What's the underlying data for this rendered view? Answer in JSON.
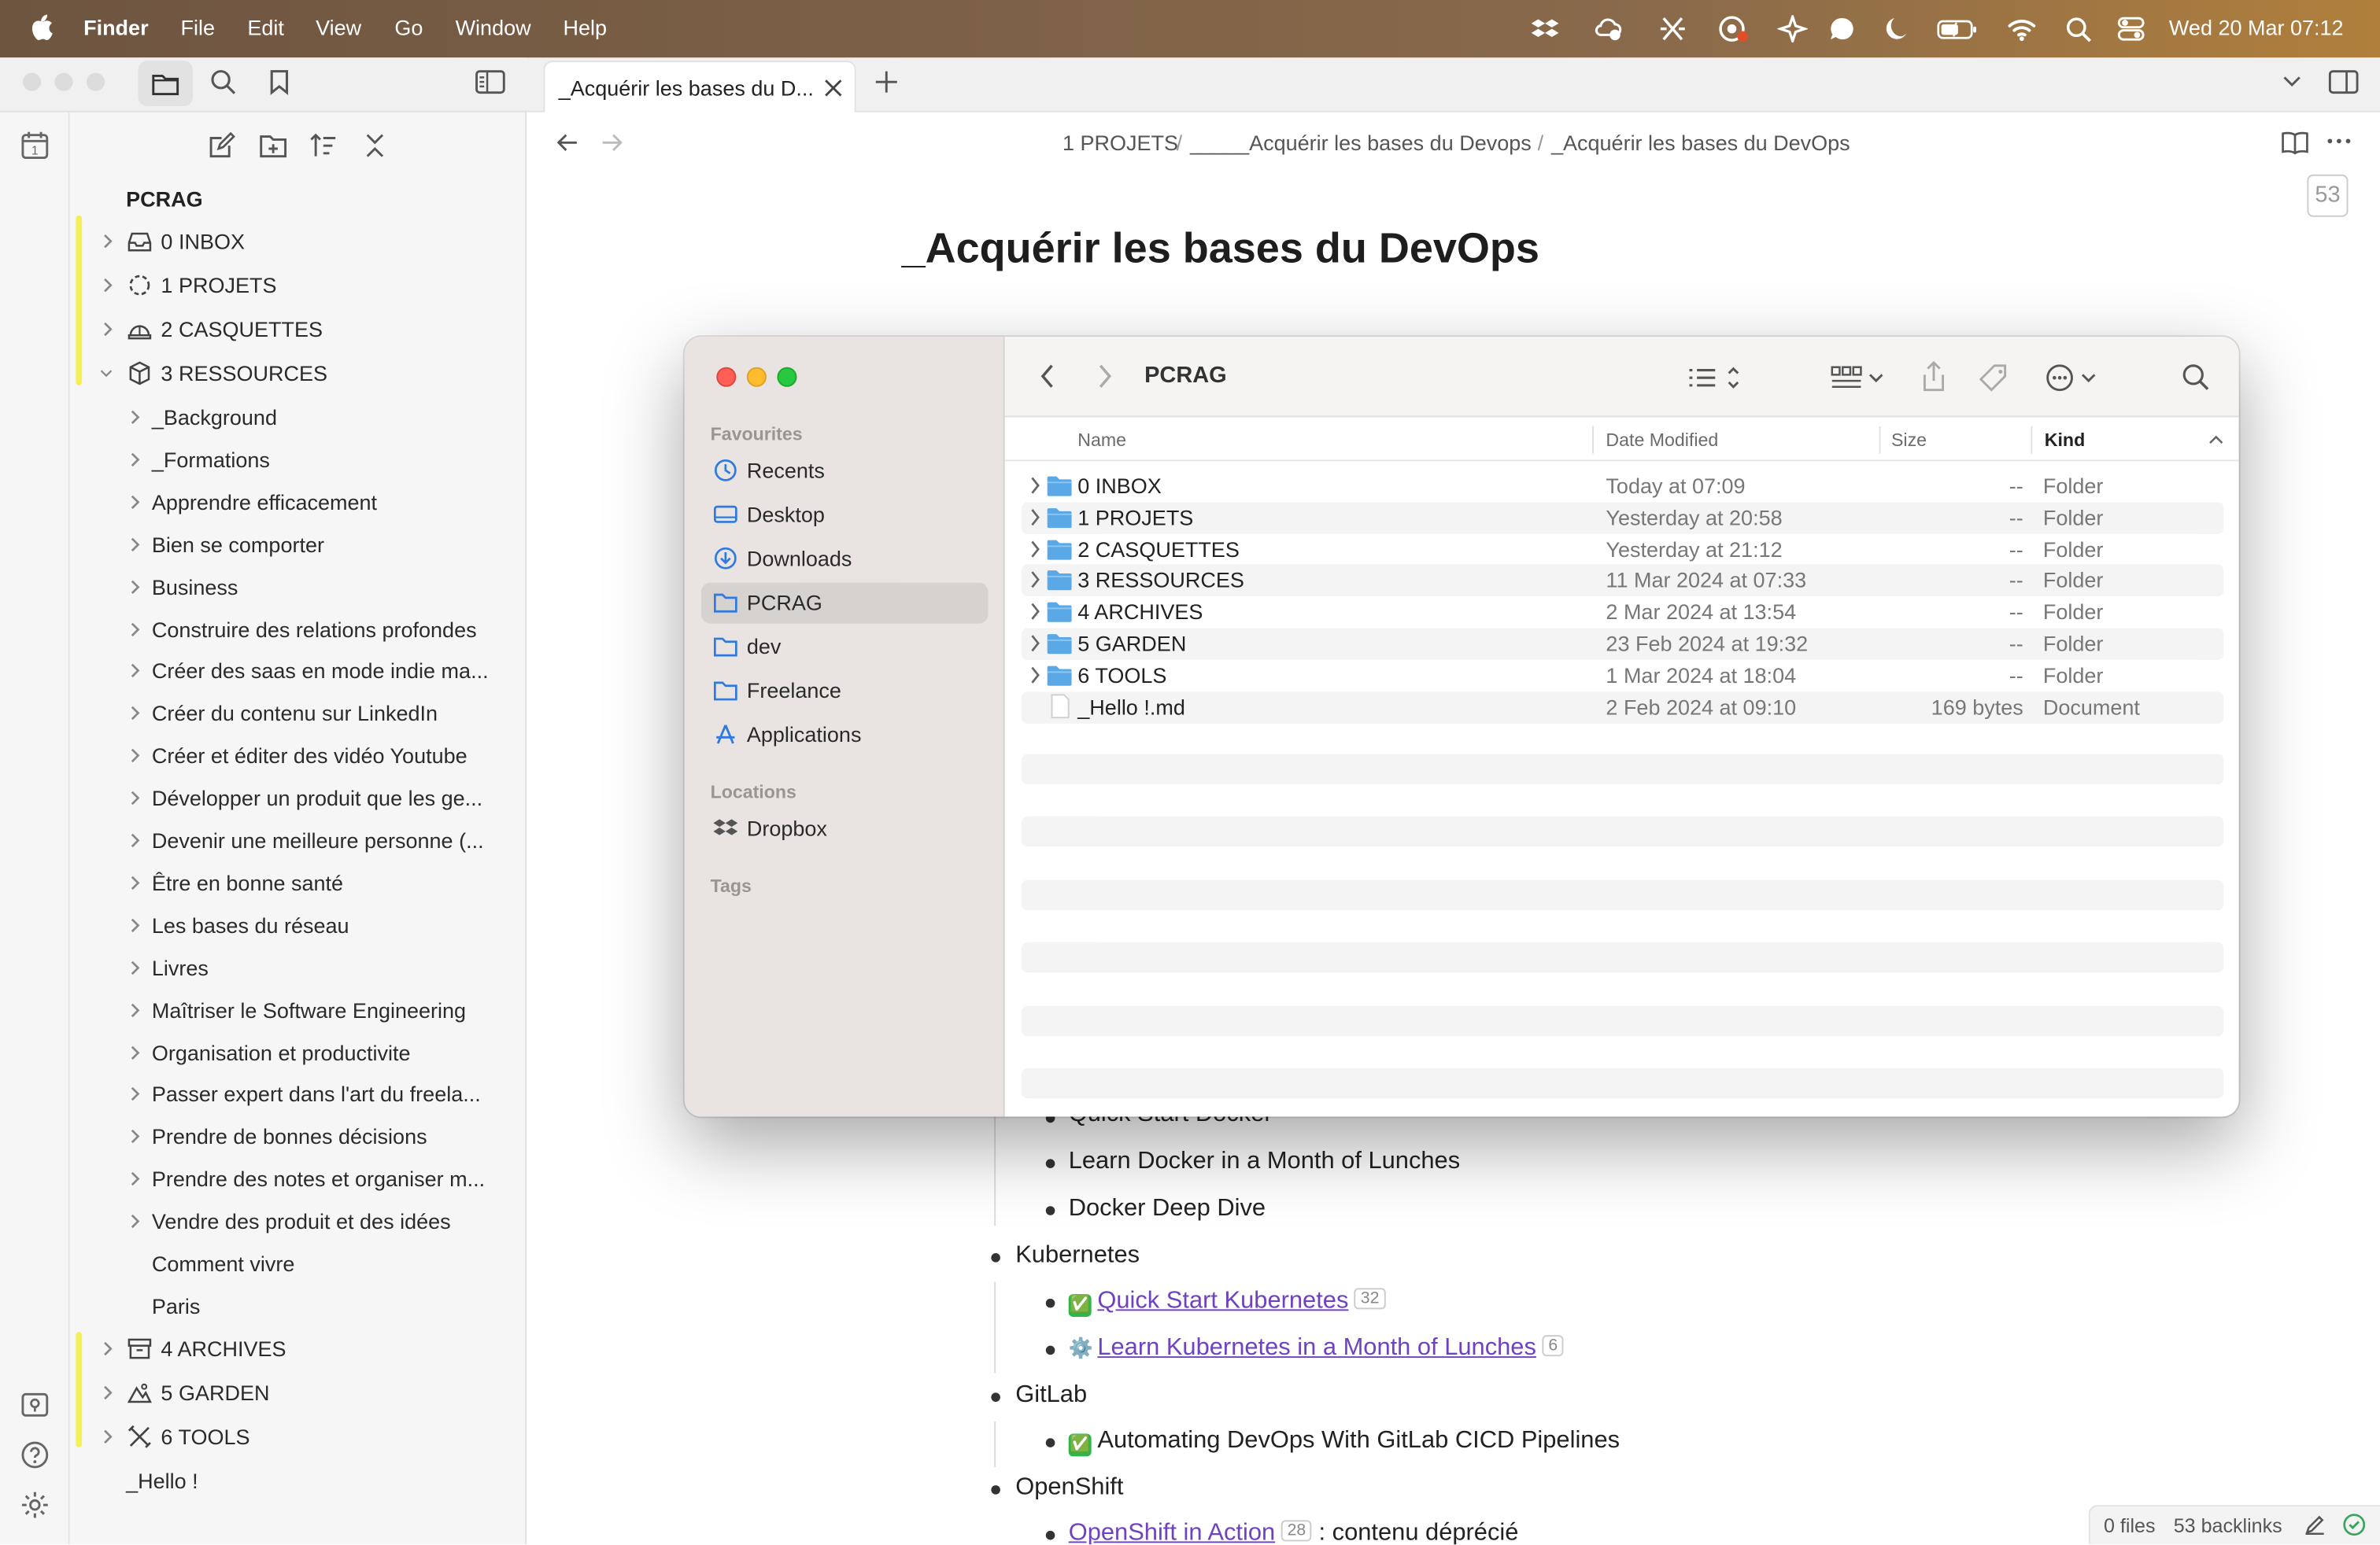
{
  "menubar": {
    "app": "Finder",
    "items": [
      "File",
      "Edit",
      "View",
      "Go",
      "Window",
      "Help"
    ],
    "clock": "Wed 20 Mar  07:12"
  },
  "sidebar": {
    "vault": "PCRAG",
    "folders": [
      {
        "label": "0 INBOX",
        "icon": "inbox-icon"
      },
      {
        "label": "1 PROJETS",
        "icon": "dotted-circle-icon"
      },
      {
        "label": "2 CASQUETTES",
        "icon": "cap-icon"
      },
      {
        "label": "3 RESSOURCES",
        "icon": "box-icon"
      }
    ],
    "subfolders": [
      "_Background",
      "_Formations",
      "Apprendre efficacement",
      "Bien se comporter",
      "Business",
      "Construire des relations profondes",
      "Créer des saas en mode indie ma...",
      "Créer du contenu sur LinkedIn",
      "Créer et éditer des vidéo Youtube",
      "Développer un produit que les ge...",
      "Devenir une meilleure personne (...",
      "Être en bonne santé",
      "Les bases du réseau",
      "Livres",
      "Maîtriser le Software Engineering",
      "Organisation et productivite",
      "Passer expert dans l'art du freela...",
      "Prendre de bonnes décisions",
      "Prendre des notes et organiser m...",
      "Vendre des produit et des idées"
    ],
    "plain_items": [
      "Comment vivre",
      "Paris"
    ],
    "bottom_folders": [
      {
        "label": "4 ARCHIVES",
        "icon": "archive-icon"
      },
      {
        "label": "5 GARDEN",
        "icon": "garden-icon"
      },
      {
        "label": "6 TOOLS",
        "icon": "tools-icon"
      }
    ],
    "file": "_Hello !"
  },
  "tab": {
    "label": "_Acquérir les bases du D..."
  },
  "breadcrumb": [
    "1 PROJETS",
    "_____Acquérir les bases du Devops",
    "_Acquérir les bases du DevOps"
  ],
  "breadcrumb_sep": "/",
  "count_badge": "53",
  "note": {
    "title": "_Acquérir les bases du DevOps",
    "docker_items": [
      "Quick Start Docker",
      "Learn Docker in a Month of Lunches",
      "Docker Deep Dive"
    ],
    "kubernetes": {
      "label": "Kubernetes",
      "items": [
        {
          "icon": "✅",
          "text": "Quick Start Kubernetes",
          "count": "32"
        },
        {
          "icon": "⚙️",
          "text": "Learn Kubernetes in a Month of Lunches",
          "count": "6"
        }
      ]
    },
    "gitlab": {
      "label": "GitLab",
      "items": [
        {
          "icon": "✅",
          "text": "Automating DevOps With GitLab CICD Pipelines"
        }
      ]
    },
    "openshift": {
      "label": "OpenShift",
      "items": [
        {
          "text": "OpenShift in Action",
          "count": "28",
          "suffix": " : contenu déprécié"
        }
      ]
    }
  },
  "status_bar": {
    "files": "0 files",
    "backlinks": "53 backlinks"
  },
  "finder": {
    "title": "PCRAG",
    "favourites_label": "Favourites",
    "favourites": [
      {
        "label": "Recents",
        "icon": "clock-icon"
      },
      {
        "label": "Desktop",
        "icon": "desktop-icon"
      },
      {
        "label": "Downloads",
        "icon": "download-icon"
      },
      {
        "label": "PCRAG",
        "icon": "folder-icon",
        "selected": true
      },
      {
        "label": "dev",
        "icon": "folder-icon"
      },
      {
        "label": "Freelance",
        "icon": "folder-icon"
      },
      {
        "label": "Applications",
        "icon": "applications-icon"
      }
    ],
    "locations_label": "Locations",
    "locations": [
      {
        "label": "Dropbox",
        "icon": "dropbox-icon"
      }
    ],
    "tags_label": "Tags",
    "columns": {
      "name": "Name",
      "date": "Date Modified",
      "size": "Size",
      "kind": "Kind"
    },
    "rows": [
      {
        "name": "0 INBOX",
        "date": "Today at 07:09",
        "size": "--",
        "kind": "Folder",
        "type": "folder"
      },
      {
        "name": "1 PROJETS",
        "date": "Yesterday at 20:58",
        "size": "--",
        "kind": "Folder",
        "type": "folder"
      },
      {
        "name": "2 CASQUETTES",
        "date": "Yesterday at 21:12",
        "size": "--",
        "kind": "Folder",
        "type": "folder"
      },
      {
        "name": "3 RESSOURCES",
        "date": "11 Mar 2024 at 07:33",
        "size": "--",
        "kind": "Folder",
        "type": "folder"
      },
      {
        "name": "4 ARCHIVES",
        "date": "2 Mar 2024 at 13:54",
        "size": "--",
        "kind": "Folder",
        "type": "folder"
      },
      {
        "name": "5 GARDEN",
        "date": "23 Feb 2024 at 19:32",
        "size": "--",
        "kind": "Folder",
        "type": "folder"
      },
      {
        "name": "6 TOOLS",
        "date": "1 Mar 2024 at 18:04",
        "size": "--",
        "kind": "Folder",
        "type": "folder"
      },
      {
        "name": "_Hello !.md",
        "date": "2 Feb 2024 at 09:10",
        "size": "169 bytes",
        "kind": "Document",
        "type": "file"
      }
    ]
  },
  "colors": {
    "highlight": "#f5ef3b",
    "folder_blue": "#5aa9e6",
    "link": "#6f42c1"
  }
}
